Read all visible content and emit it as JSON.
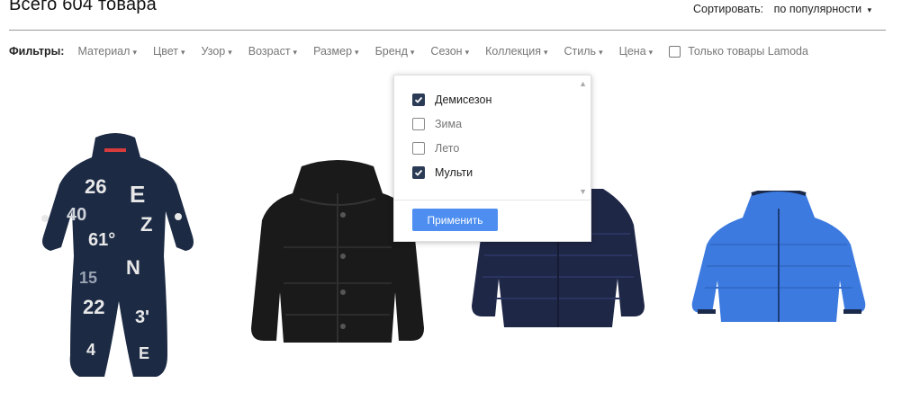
{
  "header": {
    "title": "Всего 604 товара",
    "sort_label": "Сортировать:",
    "sort_value": "по популярности"
  },
  "filters": {
    "label": "Фильтры:",
    "items": [
      "Материал",
      "Цвет",
      "Узор",
      "Возраст",
      "Размер",
      "Бренд",
      "Сезон",
      "Коллекция",
      "Стиль",
      "Цена"
    ],
    "only_lamoda": "Только товары Lamoda"
  },
  "season_dropdown": {
    "options": [
      {
        "label": "Демисезон",
        "checked": true
      },
      {
        "label": "Зима",
        "checked": false
      },
      {
        "label": "Лето",
        "checked": false
      },
      {
        "label": "Мульти",
        "checked": true
      }
    ],
    "apply_label": "Применить"
  },
  "products": [
    {
      "name": "snowsuit-navy-print",
      "color": "#1c2a44"
    },
    {
      "name": "black-puffer-jacket",
      "color": "#1a1a1a"
    },
    {
      "name": "navy-puffer-jacket",
      "color": "#1f2747"
    },
    {
      "name": "blue-puffer-jacket",
      "color": "#3c7ae0"
    }
  ],
  "colors": {
    "accent": "#4d8ef0",
    "checkbox_checked": "#2b3a55"
  }
}
